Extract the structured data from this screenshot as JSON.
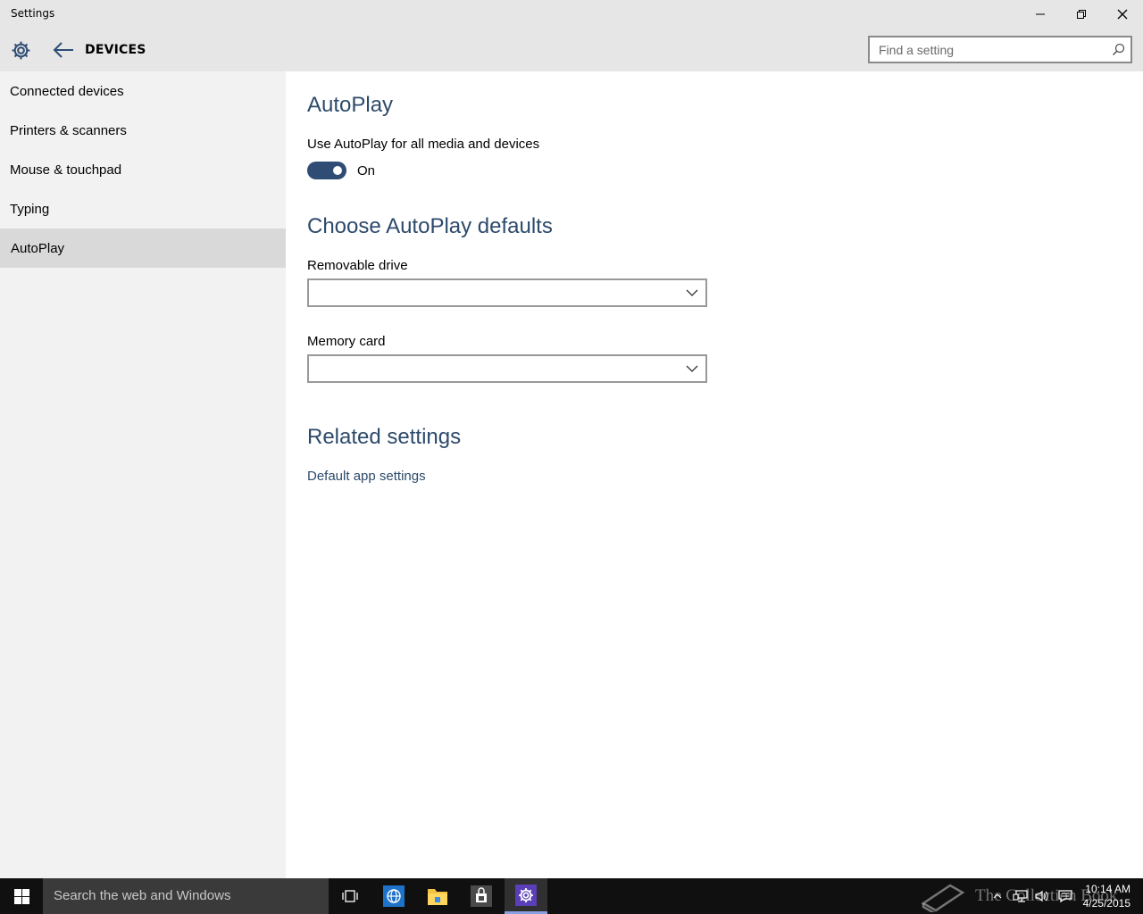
{
  "window": {
    "title": "Settings",
    "controls": [
      "minimize",
      "restore",
      "close"
    ]
  },
  "header": {
    "section": "DEVICES",
    "icons": [
      "settings-gear-icon",
      "back-arrow-icon"
    ],
    "search": {
      "placeholder": "Find a setting",
      "value": ""
    }
  },
  "sidebar": {
    "items": [
      {
        "label": "Connected devices",
        "active": false
      },
      {
        "label": "Printers & scanners",
        "active": false
      },
      {
        "label": "Mouse & touchpad",
        "active": false
      },
      {
        "label": "Typing",
        "active": false
      },
      {
        "label": "AutoPlay",
        "active": true
      }
    ]
  },
  "main": {
    "title": "AutoPlay",
    "toggle_label": "Use AutoPlay for all media and devices",
    "toggle_state": "On",
    "toggle_on": true,
    "defaults_title": "Choose AutoPlay defaults",
    "removable_label": "Removable drive",
    "removable_value": "",
    "memory_label": "Memory card",
    "memory_value": "",
    "related_title": "Related settings",
    "related_link": "Default app settings"
  },
  "taskbar": {
    "search_text": "Search the web and Windows",
    "apps": [
      "task-view-icon",
      "internet-explorer-icon",
      "file-explorer-icon",
      "store-icon",
      "settings-icon"
    ],
    "active_app": "settings-icon",
    "time": "10:14 AM",
    "date": "4/25/2015",
    "watermark": "The Collection Book"
  },
  "colors": {
    "accent": "#2e4c74",
    "heading": "#2d4a6b",
    "sidebar_bg": "#f2f2f2",
    "header_bg": "#e6e6e6",
    "taskbar_bg": "#101010"
  }
}
